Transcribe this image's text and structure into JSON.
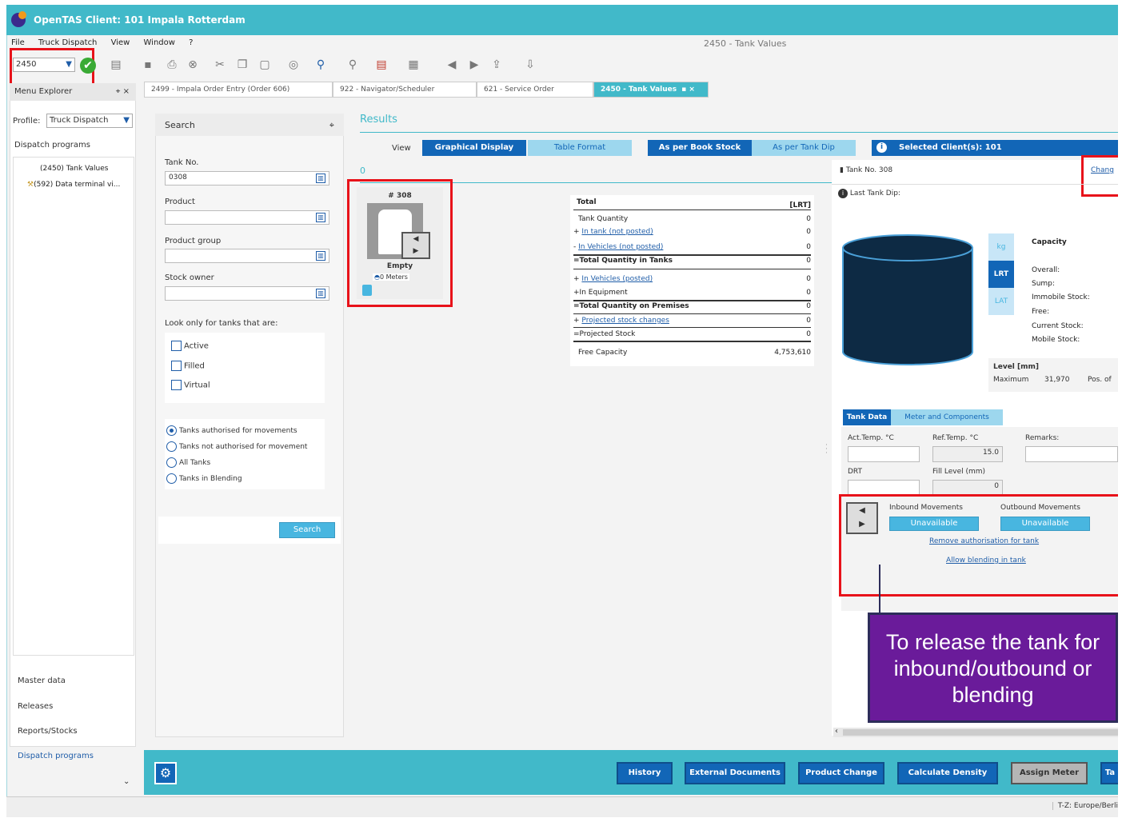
{
  "app": {
    "title": "OpenTAS  Client: 101 Impala Rotterdam",
    "doc_title": "2450 - Tank Values"
  },
  "menu": [
    "File",
    "Truck Dispatch",
    "View",
    "Window",
    "?"
  ],
  "toolbar": {
    "program_value": "2450"
  },
  "tabs": [
    {
      "label": "2499 - Impala Order Entry (Order 606)"
    },
    {
      "label": "922 - Navigator/Scheduler"
    },
    {
      "label": "621 - Service Order"
    },
    {
      "label": "2450 - Tank Values",
      "active": true
    }
  ],
  "menu_explorer": {
    "title": "Menu Explorer",
    "profile_label": "Profile:",
    "profile_value": "Truck Dispatch",
    "section": "Dispatch programs",
    "items": [
      "(2450) Tank Values",
      "(592) Data terminal vi..."
    ],
    "bottom": [
      "Master data",
      "Releases",
      "Reports/Stocks",
      "Dispatch programs"
    ]
  },
  "search": {
    "title": "Search",
    "tank_no_label": "Tank No.",
    "tank_no_value": "0308",
    "product_label": "Product",
    "product_group_label": "Product group",
    "stock_owner_label": "Stock owner",
    "look_label": "Look only for tanks that are:",
    "checks": [
      "Active",
      "Filled",
      "Virtual"
    ],
    "radios": [
      "Tanks authorised for movements",
      "Tanks not authorised for movement",
      "All Tanks",
      "Tanks in Blending"
    ],
    "button": "Search"
  },
  "results": {
    "title": "Results",
    "view_label": "View",
    "view_opts": [
      "Graphical Display",
      "Table Format"
    ],
    "stock_opts": [
      "As per Book Stock",
      "As per Tank Dip"
    ],
    "client_label": "Selected Client(s): 101",
    "count": "0",
    "tank": {
      "number": "# 308",
      "status": "Empty",
      "meters": "0 Meters"
    }
  },
  "summary": {
    "title": "Total",
    "unit": "[LRT]",
    "rows": [
      {
        "label": "Tank Quantity",
        "value": "0"
      },
      {
        "label": "In tank (not posted)",
        "value": "0",
        "link": true,
        "prefix": "+"
      },
      {
        "label": "In Vehicles (not posted)",
        "value": "0",
        "link": true,
        "prefix": "-"
      },
      {
        "label": "Total Quantity in Tanks",
        "value": "0",
        "bold": true,
        "prefix": "="
      },
      {
        "label": "In Vehicles (posted)",
        "value": "0",
        "link": true,
        "prefix": "+"
      },
      {
        "label": "In Equipment",
        "value": "0",
        "prefix": "+"
      },
      {
        "label": "Total Quantity on Premises",
        "value": "0",
        "bold": true,
        "prefix": "="
      },
      {
        "label": "Projected stock changes",
        "value": "0",
        "link": true,
        "prefix": "+"
      },
      {
        "label": "Projected Stock",
        "value": "0",
        "prefix": "="
      },
      {
        "label": "Free Capacity",
        "value": "4,753,610"
      }
    ]
  },
  "detail": {
    "tank_no": "Tank No. 308",
    "change_link": "Chang",
    "last_dip": "Last Tank Dip:",
    "units": [
      "kg",
      "LRT",
      "LAT"
    ],
    "capacity_title": "Capacity",
    "capacity_rows": [
      "Overall:",
      "Sump:",
      "Immobile Stock:",
      "Free:",
      "Current Stock:",
      "Mobile Stock:"
    ],
    "level_title": "Level [mm]",
    "level_max_label": "Maximum",
    "level_max_value": "31,970",
    "level_pos": "Pos. of",
    "subtabs": [
      "Tank Data",
      "Meter and Components"
    ],
    "act_temp": "Act.Temp. °C",
    "ref_temp": "Ref.Temp. °C",
    "ref_temp_value": "15.0",
    "remarks": "Remarks:",
    "drt": "DRT",
    "fill_level": "Fill Level (mm)",
    "fill_level_value": "0",
    "inbound": "Inbound Movements",
    "outbound": "Outbound Movements",
    "unavailable": "Unavailable",
    "remove_auth": "Remove authorisation for tank",
    "allow_blend": "Allow blending in tank"
  },
  "callout": "To release the tank for inbound/outbound or blending",
  "bottom_buttons": [
    "History",
    "External Documents",
    "Product Change",
    "Calculate Density",
    "Assign Meter",
    "Ta"
  ],
  "status": "T-Z: Europe/Berli"
}
